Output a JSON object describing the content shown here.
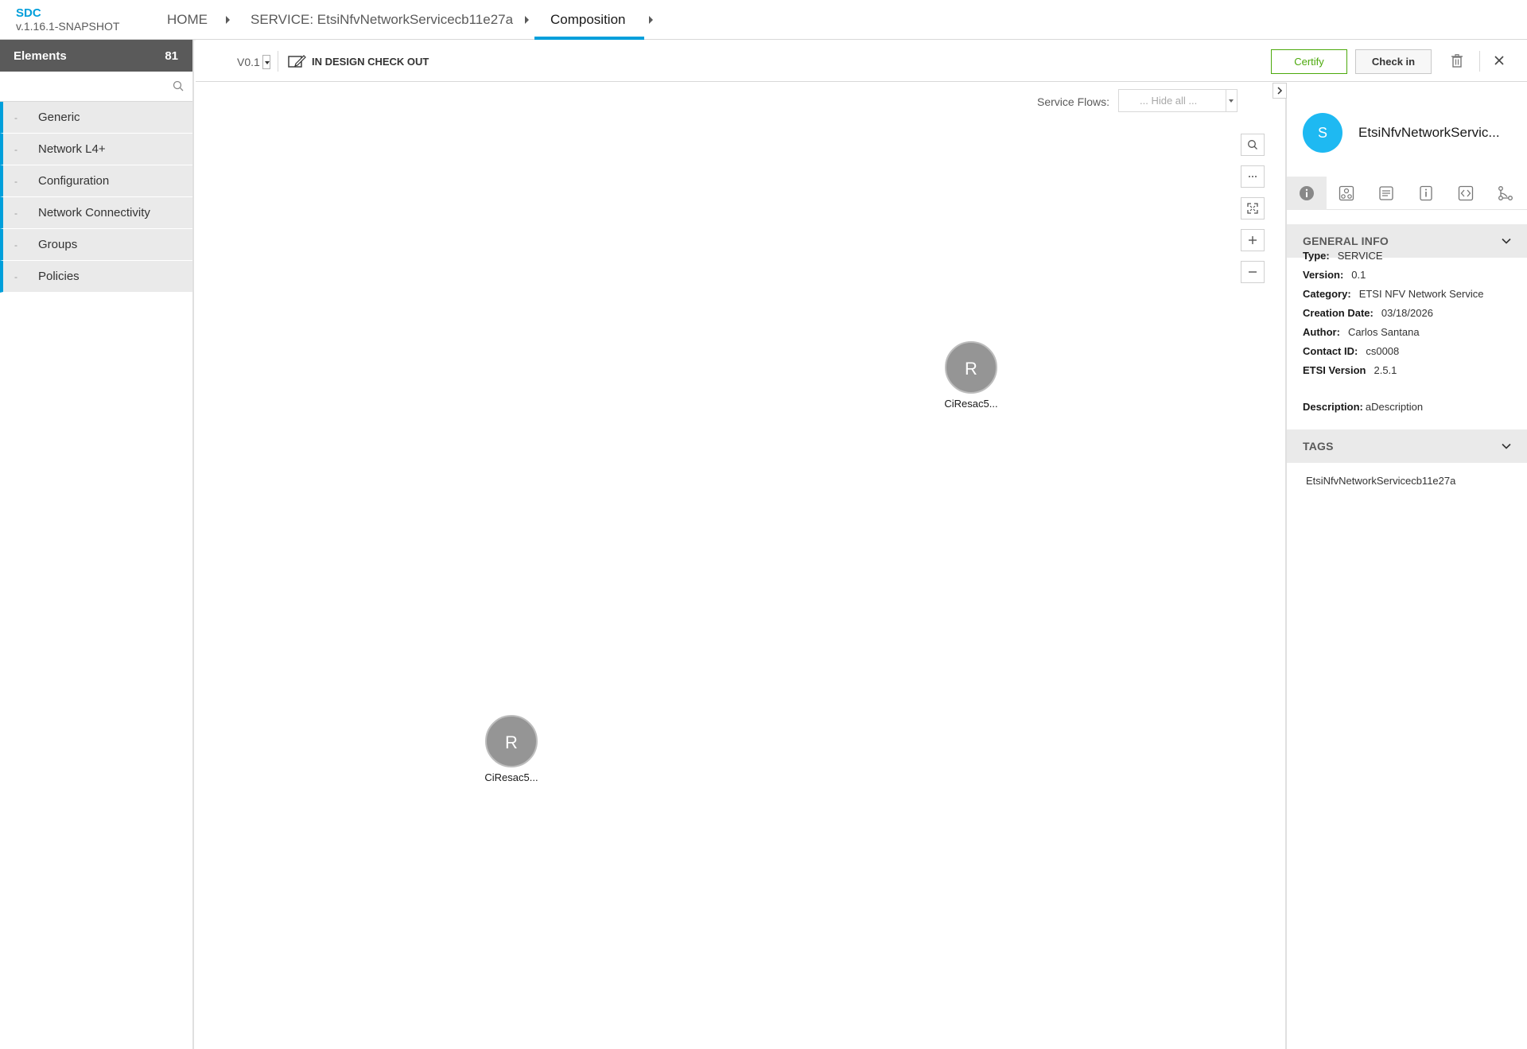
{
  "app": {
    "name": "SDC",
    "version": "v.1.16.1-SNAPSHOT"
  },
  "breadcrumbs": [
    {
      "label": "HOME"
    },
    {
      "label": "SERVICE: EtsiNfvNetworkServicecb11e27a"
    },
    {
      "label": "Composition"
    }
  ],
  "palette": {
    "title": "Elements",
    "count": "81",
    "search_placeholder": "",
    "groups": [
      {
        "label": "Generic"
      },
      {
        "label": "Network L4+"
      },
      {
        "label": "Configuration"
      },
      {
        "label": "Network Connectivity"
      },
      {
        "label": "Groups"
      },
      {
        "label": "Policies"
      }
    ]
  },
  "toolbar": {
    "version": "V0.1",
    "lifecycle_state": "IN DESIGN CHECK OUT",
    "certify_label": "Certify",
    "checkin_label": "Check in"
  },
  "canvas": {
    "service_flows_label": "Service Flows:",
    "service_flows_value": "... Hide all ...",
    "zoom_controls": [
      "search-icon",
      "more-icon",
      "fit-icon",
      "zoom-in-icon",
      "zoom-out-icon"
    ],
    "nodes": [
      {
        "initial": "R",
        "label": "CiResac5..."
      },
      {
        "initial": "R",
        "label": "CiResac5..."
      }
    ]
  },
  "panel": {
    "avatar_initial": "S",
    "title": "EtsiNfvNetworkServic...",
    "tabs": [
      "info-icon",
      "composition-icon",
      "artifacts-icon",
      "properties-icon",
      "api-icon",
      "paths-icon"
    ],
    "general_info_heading": "GENERAL INFO",
    "info": [
      {
        "key": "Type:",
        "value": "SERVICE"
      },
      {
        "key": "Version:",
        "value": "0.1"
      },
      {
        "key": "Category:",
        "value": "ETSI NFV Network Service"
      },
      {
        "key": "Creation Date:",
        "value": "03/18/2026"
      },
      {
        "key": "Author:",
        "value": "Carlos Santana"
      },
      {
        "key": "Contact ID:",
        "value": "cs0008"
      },
      {
        "key": "ETSI Version",
        "value": "2.5.1"
      }
    ],
    "description_key": "Description:",
    "description_value": "aDescription",
    "tags_heading": "TAGS",
    "tags": [
      "EtsiNfvNetworkServicecb11e27a"
    ]
  },
  "colors": {
    "accent": "#009fdb",
    "certify": "#4ca90c",
    "node": "#959595",
    "avatar": "#1eb9f2"
  }
}
